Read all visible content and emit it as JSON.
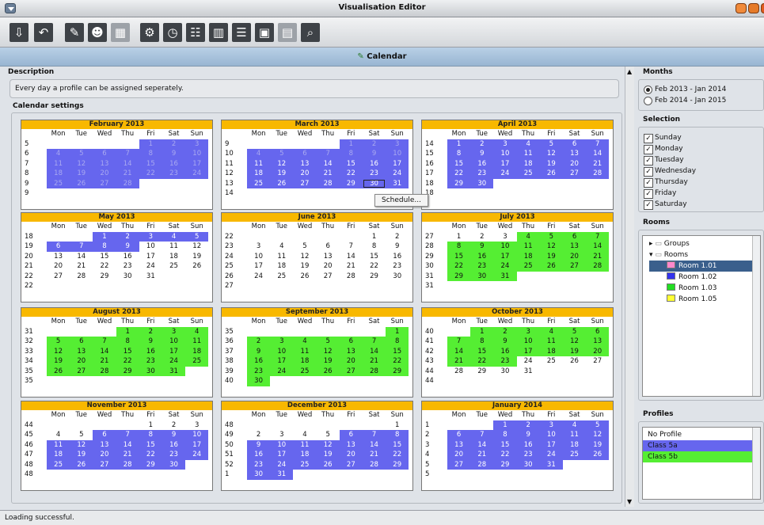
{
  "window": {
    "title": "Visualisation Editor"
  },
  "header": {
    "title": "Calendar"
  },
  "description": {
    "heading": "Description",
    "text": "Every day a profile can be assigned seperately."
  },
  "calendar": {
    "heading": "Calendar settings",
    "day_headers": [
      "Mon",
      "Tue",
      "Wed",
      "Thu",
      "Fri",
      "Sat",
      "Sun"
    ],
    "months": [
      {
        "name": "February 2013",
        "weeks": [
          [
            "5",
            null,
            null,
            null,
            null,
            "1",
            "2",
            "3"
          ],
          [
            "6",
            "4",
            "5",
            "6",
            "7",
            "8",
            "9",
            "10"
          ],
          [
            "7",
            "11",
            "12",
            "13",
            "14",
            "15",
            "16",
            "17"
          ],
          [
            "8",
            "18",
            "19",
            "20",
            "21",
            "22",
            "23",
            "24"
          ],
          [
            "9",
            "25",
            "26",
            "27",
            "28",
            null,
            null,
            null
          ],
          [
            "9",
            null,
            null,
            null,
            null,
            null,
            null,
            null
          ]
        ]
      },
      {
        "name": "March 2013",
        "weeks": [
          [
            "9",
            null,
            null,
            null,
            null,
            "1",
            "2",
            "3"
          ],
          [
            "10",
            "4",
            "5",
            "6",
            "7",
            "8",
            "9",
            "10"
          ],
          [
            "11",
            "11",
            "12",
            "13",
            "14",
            "15",
            "16",
            "17"
          ],
          [
            "12",
            "18",
            "19",
            "20",
            "21",
            "22",
            "23",
            "24"
          ],
          [
            "13",
            "25",
            "26",
            "27",
            "28",
            "29",
            "30",
            "31"
          ],
          [
            "14",
            null,
            null,
            null,
            null,
            null,
            null,
            null
          ]
        ]
      },
      {
        "name": "April 2013",
        "weeks": [
          [
            "14",
            "1",
            "2",
            "3",
            "4",
            "5",
            "6",
            "7"
          ],
          [
            "15",
            "8",
            "9",
            "10",
            "11",
            "12",
            "13",
            "14"
          ],
          [
            "16",
            "15",
            "16",
            "17",
            "18",
            "19",
            "20",
            "21"
          ],
          [
            "17",
            "22",
            "23",
            "24",
            "25",
            "26",
            "27",
            "28"
          ],
          [
            "18",
            "29",
            "30",
            null,
            null,
            null,
            null,
            null
          ],
          [
            "18",
            null,
            null,
            null,
            null,
            null,
            null,
            null
          ]
        ]
      },
      {
        "name": "May 2013",
        "weeks": [
          [
            "18",
            null,
            null,
            "1",
            "2",
            "3",
            "4",
            "5"
          ],
          [
            "19",
            "6",
            "7",
            "8",
            "9",
            "10",
            "11",
            "12"
          ],
          [
            "20",
            "13",
            "14",
            "15",
            "16",
            "17",
            "18",
            "19"
          ],
          [
            "21",
            "20",
            "21",
            "22",
            "23",
            "24",
            "25",
            "26"
          ],
          [
            "22",
            "27",
            "28",
            "29",
            "30",
            "31",
            null,
            null
          ],
          [
            "22",
            null,
            null,
            null,
            null,
            null,
            null,
            null
          ]
        ]
      },
      {
        "name": "June 2013",
        "weeks": [
          [
            "22",
            null,
            null,
            null,
            null,
            null,
            "1",
            "2"
          ],
          [
            "23",
            "3",
            "4",
            "5",
            "6",
            "7",
            "8",
            "9"
          ],
          [
            "24",
            "10",
            "11",
            "12",
            "13",
            "14",
            "15",
            "16"
          ],
          [
            "25",
            "17",
            "18",
            "19",
            "20",
            "21",
            "22",
            "23"
          ],
          [
            "26",
            "24",
            "25",
            "26",
            "27",
            "28",
            "29",
            "30"
          ],
          [
            "27",
            null,
            null,
            null,
            null,
            null,
            null,
            null
          ]
        ]
      },
      {
        "name": "July 2013",
        "weeks": [
          [
            "27",
            "1",
            "2",
            "3",
            "4",
            "5",
            "6",
            "7"
          ],
          [
            "28",
            "8",
            "9",
            "10",
            "11",
            "12",
            "13",
            "14"
          ],
          [
            "29",
            "15",
            "16",
            "17",
            "18",
            "19",
            "20",
            "21"
          ],
          [
            "30",
            "22",
            "23",
            "24",
            "25",
            "26",
            "27",
            "28"
          ],
          [
            "31",
            "29",
            "30",
            "31",
            null,
            null,
            null,
            null
          ],
          [
            "31",
            null,
            null,
            null,
            null,
            null,
            null,
            null
          ]
        ]
      },
      {
        "name": "August 2013",
        "weeks": [
          [
            "31",
            null,
            null,
            null,
            "1",
            "2",
            "3",
            "4"
          ],
          [
            "32",
            "5",
            "6",
            "7",
            "8",
            "9",
            "10",
            "11"
          ],
          [
            "33",
            "12",
            "13",
            "14",
            "15",
            "16",
            "17",
            "18"
          ],
          [
            "34",
            "19",
            "20",
            "21",
            "22",
            "23",
            "24",
            "25"
          ],
          [
            "35",
            "26",
            "27",
            "28",
            "29",
            "30",
            "31",
            null
          ],
          [
            "35",
            null,
            null,
            null,
            null,
            null,
            null,
            null
          ]
        ]
      },
      {
        "name": "September 2013",
        "weeks": [
          [
            "35",
            null,
            null,
            null,
            null,
            null,
            null,
            "1"
          ],
          [
            "36",
            "2",
            "3",
            "4",
            "5",
            "6",
            "7",
            "8"
          ],
          [
            "37",
            "9",
            "10",
            "11",
            "12",
            "13",
            "14",
            "15"
          ],
          [
            "38",
            "16",
            "17",
            "18",
            "19",
            "20",
            "21",
            "22"
          ],
          [
            "39",
            "23",
            "24",
            "25",
            "26",
            "27",
            "28",
            "29"
          ],
          [
            "40",
            "30",
            null,
            null,
            null,
            null,
            null,
            null
          ]
        ]
      },
      {
        "name": "October 2013",
        "weeks": [
          [
            "40",
            null,
            "1",
            "2",
            "3",
            "4",
            "5",
            "6"
          ],
          [
            "41",
            "7",
            "8",
            "9",
            "10",
            "11",
            "12",
            "13"
          ],
          [
            "42",
            "14",
            "15",
            "16",
            "17",
            "18",
            "19",
            "20"
          ],
          [
            "43",
            "21",
            "22",
            "23",
            "24",
            "25",
            "26",
            "27"
          ],
          [
            "44",
            "28",
            "29",
            "30",
            "31",
            null,
            null,
            null
          ],
          [
            "44",
            null,
            null,
            null,
            null,
            null,
            null,
            null
          ]
        ]
      },
      {
        "name": "November 2013",
        "weeks": [
          [
            "44",
            null,
            null,
            null,
            null,
            "1",
            "2",
            "3"
          ],
          [
            "45",
            "4",
            "5",
            "6",
            "7",
            "8",
            "9",
            "10"
          ],
          [
            "46",
            "11",
            "12",
            "13",
            "14",
            "15",
            "16",
            "17"
          ],
          [
            "47",
            "18",
            "19",
            "20",
            "21",
            "22",
            "23",
            "24"
          ],
          [
            "48",
            "25",
            "26",
            "27",
            "28",
            "29",
            "30",
            null
          ],
          [
            "48",
            null,
            null,
            null,
            null,
            null,
            null,
            null
          ]
        ]
      },
      {
        "name": "December 2013",
        "weeks": [
          [
            "48",
            null,
            null,
            null,
            null,
            null,
            null,
            "1"
          ],
          [
            "49",
            "2",
            "3",
            "4",
            "5",
            "6",
            "7",
            "8"
          ],
          [
            "50",
            "9",
            "10",
            "11",
            "12",
            "13",
            "14",
            "15"
          ],
          [
            "51",
            "16",
            "17",
            "18",
            "19",
            "20",
            "21",
            "22"
          ],
          [
            "52",
            "23",
            "24",
            "25",
            "26",
            "27",
            "28",
            "29"
          ],
          [
            "1",
            "30",
            "31",
            null,
            null,
            null,
            null,
            null
          ]
        ]
      },
      {
        "name": "January 2014",
        "weeks": [
          [
            "1",
            null,
            null,
            "1",
            "2",
            "3",
            "4",
            "5"
          ],
          [
            "2",
            "6",
            "7",
            "8",
            "9",
            "10",
            "11",
            "12"
          ],
          [
            "3",
            "13",
            "14",
            "15",
            "16",
            "17",
            "18",
            "19"
          ],
          [
            "4",
            "20",
            "21",
            "22",
            "23",
            "24",
            "25",
            "26"
          ],
          [
            "5",
            "27",
            "28",
            "29",
            "30",
            "31",
            null,
            null
          ],
          [
            "5",
            null,
            null,
            null,
            null,
            null,
            null,
            null
          ]
        ]
      }
    ]
  },
  "context_menu": {
    "item": "Schedule..."
  },
  "months_panel": {
    "heading": "Months",
    "options": [
      {
        "label": "Feb 2013 - Jan 2014",
        "selected": true
      },
      {
        "label": "Feb 2014 - Jan 2015",
        "selected": false
      }
    ]
  },
  "selection_panel": {
    "heading": "Selection",
    "days": [
      "Sunday",
      "Monday",
      "Tuesday",
      "Wednesday",
      "Thursday",
      "Friday",
      "Saturday"
    ]
  },
  "rooms_panel": {
    "heading": "Rooms",
    "groups_label": "Groups",
    "rooms_label": "Rooms",
    "rooms": [
      {
        "label": "Room 1.01",
        "color": "#ff88cc"
      },
      {
        "label": "Room 1.02",
        "color": "#3333ee"
      },
      {
        "label": "Room 1.03",
        "color": "#22dd22"
      },
      {
        "label": "Room 1.05",
        "color": "#ffff33"
      }
    ]
  },
  "profiles_panel": {
    "heading": "Profiles",
    "items": [
      {
        "label": "No Profile",
        "color": "#ffffff"
      },
      {
        "label": "Class 5a",
        "color": "#6666ee"
      },
      {
        "label": "Class 5b",
        "color": "#55ee33"
      }
    ]
  },
  "status": {
    "text": "Loading successful."
  },
  "colors": {
    "blue": "#6666ee",
    "green": "#55ee33",
    "header": "#f8b800"
  }
}
